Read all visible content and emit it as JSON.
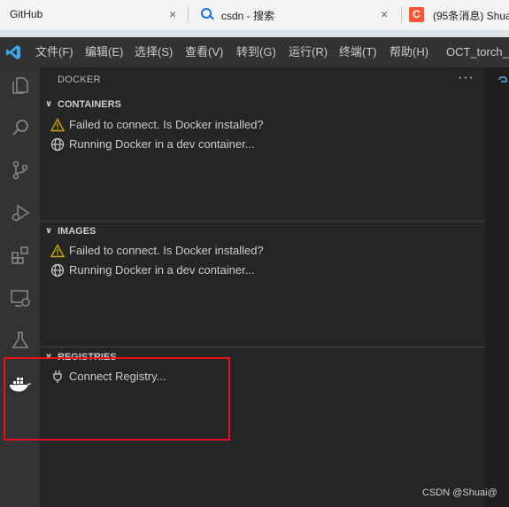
{
  "browser": {
    "tabs": [
      {
        "title": "GitHub"
      },
      {
        "title": "csdn - 搜索"
      },
      {
        "title": "(95条消息) Shua"
      }
    ],
    "close_glyph": "×"
  },
  "titlebar": {
    "menus": [
      "文件(F)",
      "编辑(E)",
      "选择(S)",
      "查看(V)",
      "转到(G)",
      "运行(R)",
      "终端(T)",
      "帮助(H)"
    ],
    "window_title": "OCT_torch_pa"
  },
  "activity_bar": {
    "icons": [
      "explorer-icon",
      "search-icon",
      "source-control-icon",
      "run-debug-icon",
      "extensions-icon",
      "remote-explorer-icon",
      "testing-icon",
      "docker-icon"
    ]
  },
  "sidebar": {
    "title": "DOCKER",
    "more_glyph": "···",
    "sections": [
      {
        "title": "CONTAINERS",
        "items": [
          {
            "icon": "warning-icon",
            "label": "Failed to connect. Is Docker installed?"
          },
          {
            "icon": "globe-icon",
            "label": "Running Docker in a dev container..."
          }
        ]
      },
      {
        "title": "IMAGES",
        "items": [
          {
            "icon": "warning-icon",
            "label": "Failed to connect. Is Docker installed?"
          },
          {
            "icon": "globe-icon",
            "label": "Running Docker in a dev container..."
          }
        ]
      },
      {
        "title": "REGISTRIES",
        "items": [
          {
            "icon": "plug-icon",
            "label": "Connect Registry..."
          }
        ]
      }
    ]
  },
  "colors": {
    "accent_docker": "#ffffff",
    "highlight_box": "#e8101a",
    "warning": "#cca700"
  },
  "watermark": "CSDN @Shuai@"
}
